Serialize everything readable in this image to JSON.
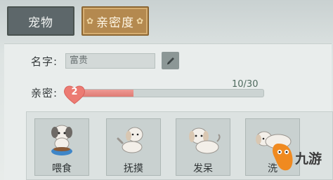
{
  "tabs": {
    "pet": "宠物",
    "intimacy": "亲密度"
  },
  "name_row": {
    "label": "名字:",
    "value": "富贵"
  },
  "intimacy_row": {
    "label": "亲密:",
    "level": "2",
    "count": "10/30",
    "progress": 0.33
  },
  "actions": [
    {
      "label": "喂食"
    },
    {
      "label": "抚摸"
    },
    {
      "label": "发呆"
    },
    {
      "label": "洗"
    }
  ],
  "watermark": {
    "text": "九游"
  },
  "colors": {
    "active_tab": "#b4894f",
    "inactive_tab": "#5d676a",
    "progress_fill": "#df7b74",
    "heart": "#ec7b73",
    "watermark_orange": "#f08a20"
  }
}
